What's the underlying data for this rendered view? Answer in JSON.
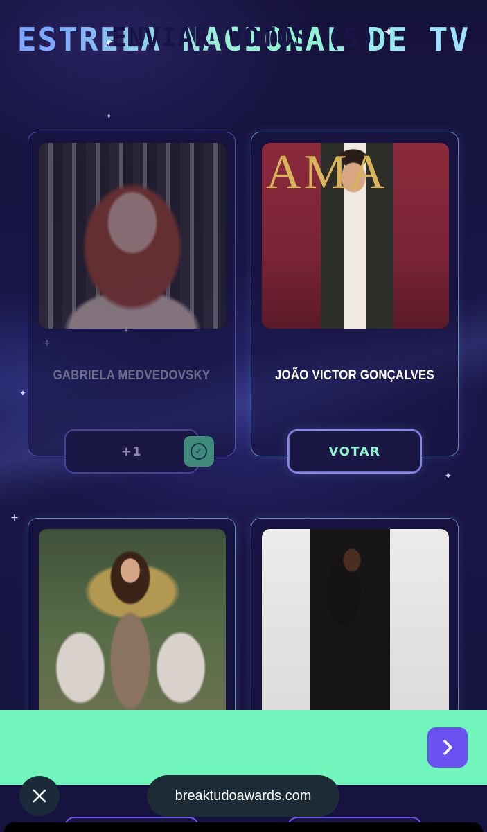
{
  "page": {
    "title": "ESTRELA NACIONAL DE TV"
  },
  "candidates": [
    {
      "name": "GABRIELA MEDVEDOVSKY",
      "button_label": "+1",
      "state": "voted",
      "photo_icon": "portrait-photo"
    },
    {
      "name": "JOÃO VICTOR GONÇALVES",
      "button_label": "VOTAR",
      "state": "not-voted",
      "photo_icon": "portrait-photo"
    },
    {
      "name": "",
      "state": "unknown",
      "photo_icon": "portrait-photo"
    },
    {
      "name": "",
      "state": "unknown",
      "photo_icon": "portrait-photo"
    }
  ],
  "send_bar": {
    "label": "ENVIAR VOTOS (5)",
    "arrow_icon": "chevron-right-icon"
  },
  "browser": {
    "url": "breaktudoawards.com",
    "close_icon": "close-icon"
  },
  "colors": {
    "background": "#15123a",
    "accent_green": "#72f5bd",
    "accent_purple": "#6a52f0",
    "text_voted": "#6e6b8c"
  }
}
